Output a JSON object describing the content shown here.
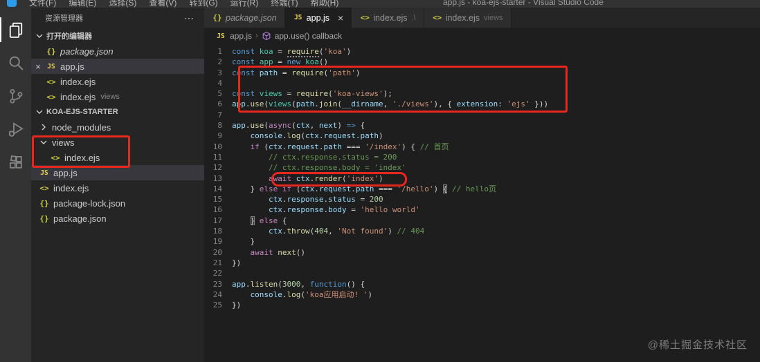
{
  "palette": {
    "annotation_red": "#e8261d",
    "activity_bar_bg": "#333333",
    "sidebar_bg": "#252526",
    "editor_bg": "#1e1e1e",
    "tab_active_bg": "#1e1e1e",
    "tab_inactive_bg": "#2d2d2d",
    "selection_row_bg": "#37373d",
    "keyword_blue": "#569cd6",
    "keyword_purple": "#c586c0",
    "class_teal": "#4ec9b0",
    "variable_blue": "#9cdcfe",
    "function_yellow": "#dcdcaa",
    "string_orange": "#ce9178",
    "number_green": "#b5cea8",
    "comment_green": "#6a9955"
  },
  "window": {
    "title": "app.js - koa-ejs-starter - Visual Studio Code",
    "menu_items": [
      "文件(F)",
      "编辑(E)",
      "选择(S)",
      "查看(V)",
      "转到(G)",
      "运行(R)",
      "终端(T)",
      "帮助(H)"
    ]
  },
  "activity_bar": [
    {
      "name": "explorer",
      "active": true
    },
    {
      "name": "search",
      "active": false
    },
    {
      "name": "source-control",
      "active": false
    },
    {
      "name": "run-debug",
      "active": false
    },
    {
      "name": "extensions",
      "active": false
    }
  ],
  "sidebar": {
    "title": "资源管理器",
    "actions_label": "⋯",
    "open_editors_label": "打开的编辑器",
    "open_editors": [
      {
        "label": "package.json",
        "icon": "json",
        "italic": true,
        "active": false,
        "close": ""
      },
      {
        "label": "app.js",
        "icon": "js",
        "italic": false,
        "active": true,
        "close": "×"
      },
      {
        "label": "index.ejs",
        "icon": "ejs",
        "italic": false,
        "active": false,
        "close": ""
      },
      {
        "label": "index.ejs",
        "icon": "ejs",
        "suffix": "views",
        "italic": false,
        "active": false,
        "close": ""
      }
    ],
    "project_label": "KOA-EJS-STARTER",
    "tree": [
      {
        "label": "node_modules",
        "kind": "folder",
        "state": "collapsed",
        "indent": 0,
        "selected": false
      },
      {
        "label": "views",
        "kind": "folder",
        "state": "expanded",
        "indent": 0,
        "selected": false
      },
      {
        "label": "index.ejs",
        "kind": "file",
        "icon": "ejs",
        "indent": 1,
        "selected": false
      },
      {
        "label": "app.js",
        "kind": "file",
        "icon": "js",
        "indent": 0,
        "selected": true
      },
      {
        "label": "index.ejs",
        "kind": "file",
        "icon": "ejs",
        "indent": 0,
        "selected": false
      },
      {
        "label": "package-lock.json",
        "kind": "file",
        "icon": "json",
        "indent": 0,
        "selected": false
      },
      {
        "label": "package.json",
        "kind": "file",
        "icon": "json",
        "indent": 0,
        "selected": false
      }
    ]
  },
  "file_icons": {
    "json": "{}",
    "js": "JS",
    "ejs": "<>"
  },
  "tabs": [
    {
      "label": "package.json",
      "icon": "json",
      "italic": true,
      "active": false,
      "suffix": "",
      "close": ""
    },
    {
      "label": "app.js",
      "icon": "js",
      "italic": false,
      "active": true,
      "suffix": "",
      "close": "×"
    },
    {
      "label": "index.ejs",
      "icon": "ejs",
      "italic": false,
      "active": false,
      "suffix": ".\\",
      "close": ""
    },
    {
      "label": "index.ejs",
      "icon": "ejs",
      "italic": false,
      "active": false,
      "suffix": "views",
      "close": ""
    }
  ],
  "breadcrumb": {
    "file": "app.js",
    "separator": "›",
    "symbol": "app.use() callback"
  },
  "editor": {
    "lines": [
      {
        "n": "1",
        "tokens": [
          {
            "c": "kw",
            "t": "const "
          },
          {
            "c": "cls",
            "t": "koa"
          },
          {
            "c": "pun",
            "t": " = "
          },
          {
            "c": "fn",
            "t": "require",
            "u": 1
          },
          {
            "c": "pun",
            "t": "("
          },
          {
            "c": "str",
            "t": "'koa'"
          },
          {
            "c": "pun",
            "t": ")"
          }
        ]
      },
      {
        "n": "2",
        "tokens": [
          {
            "c": "kw",
            "t": "const "
          },
          {
            "c": "cls",
            "t": "app"
          },
          {
            "c": "pun",
            "t": " = "
          },
          {
            "c": "kw",
            "t": "new"
          },
          {
            "c": "pun",
            "t": " "
          },
          {
            "c": "cls",
            "t": "koa"
          },
          {
            "c": "pun",
            "t": "()"
          }
        ]
      },
      {
        "n": "3",
        "tokens": [
          {
            "c": "kw",
            "t": "const "
          },
          {
            "c": "var",
            "t": "path"
          },
          {
            "c": "pun",
            "t": " = "
          },
          {
            "c": "fn",
            "t": "require"
          },
          {
            "c": "pun",
            "t": "("
          },
          {
            "c": "str",
            "t": "'path'"
          },
          {
            "c": "pun",
            "t": ")"
          }
        ]
      },
      {
        "n": "4",
        "tokens": []
      },
      {
        "n": "5",
        "tokens": [
          {
            "c": "kw",
            "t": "const "
          },
          {
            "c": "cls",
            "t": "views"
          },
          {
            "c": "pun",
            "t": " = "
          },
          {
            "c": "fn",
            "t": "require"
          },
          {
            "c": "pun",
            "t": "("
          },
          {
            "c": "str",
            "t": "'koa-views'"
          },
          {
            "c": "pun",
            "t": ");"
          }
        ]
      },
      {
        "n": "6",
        "tokens": [
          {
            "c": "var",
            "t": "app"
          },
          {
            "c": "pun",
            "t": "."
          },
          {
            "c": "fn",
            "t": "use"
          },
          {
            "c": "pun",
            "t": "("
          },
          {
            "c": "cls",
            "t": "views"
          },
          {
            "c": "pun",
            "t": "("
          },
          {
            "c": "var",
            "t": "path"
          },
          {
            "c": "pun",
            "t": "."
          },
          {
            "c": "fn",
            "t": "join"
          },
          {
            "c": "pun",
            "t": "("
          },
          {
            "c": "var",
            "t": "__dirname"
          },
          {
            "c": "pun",
            "t": ", "
          },
          {
            "c": "str",
            "t": "'./views'"
          },
          {
            "c": "pun",
            "t": "), { "
          },
          {
            "c": "var",
            "t": "extension"
          },
          {
            "c": "pun",
            "t": ": "
          },
          {
            "c": "str",
            "t": "'ejs'"
          },
          {
            "c": "pun",
            "t": " }))"
          }
        ]
      },
      {
        "n": "7",
        "tokens": []
      },
      {
        "n": "8",
        "tokens": [
          {
            "c": "var",
            "t": "app"
          },
          {
            "c": "pun",
            "t": "."
          },
          {
            "c": "fn",
            "t": "use"
          },
          {
            "c": "pun",
            "t": "("
          },
          {
            "c": "ctrl",
            "t": "async"
          },
          {
            "c": "pun",
            "t": "("
          },
          {
            "c": "var",
            "t": "ctx"
          },
          {
            "c": "pun",
            "t": ", "
          },
          {
            "c": "var",
            "t": "next"
          },
          {
            "c": "pun",
            "t": ") "
          },
          {
            "c": "kw",
            "t": "=>"
          },
          {
            "c": "pun",
            "t": " {"
          }
        ]
      },
      {
        "n": "9",
        "tokens": [
          {
            "c": "pun",
            "t": "    "
          },
          {
            "c": "var",
            "t": "console"
          },
          {
            "c": "pun",
            "t": "."
          },
          {
            "c": "fn",
            "t": "log"
          },
          {
            "c": "pun",
            "t": "("
          },
          {
            "c": "var",
            "t": "ctx"
          },
          {
            "c": "pun",
            "t": "."
          },
          {
            "c": "var",
            "t": "request"
          },
          {
            "c": "pun",
            "t": "."
          },
          {
            "c": "var",
            "t": "path"
          },
          {
            "c": "pun",
            "t": ")"
          }
        ]
      },
      {
        "n": "10",
        "tokens": [
          {
            "c": "pun",
            "t": "    "
          },
          {
            "c": "ctrl",
            "t": "if"
          },
          {
            "c": "pun",
            "t": " ("
          },
          {
            "c": "var",
            "t": "ctx"
          },
          {
            "c": "pun",
            "t": "."
          },
          {
            "c": "var",
            "t": "request"
          },
          {
            "c": "pun",
            "t": "."
          },
          {
            "c": "var",
            "t": "path"
          },
          {
            "c": "pun",
            "t": " === "
          },
          {
            "c": "str",
            "t": "'/index'"
          },
          {
            "c": "pun",
            "t": ") { "
          },
          {
            "c": "com",
            "t": "// 首页"
          }
        ]
      },
      {
        "n": "11",
        "tokens": [
          {
            "c": "pun",
            "t": "        "
          },
          {
            "c": "com",
            "t": "// ctx.response.status = 200"
          }
        ]
      },
      {
        "n": "12",
        "tokens": [
          {
            "c": "pun",
            "t": "        "
          },
          {
            "c": "com",
            "t": "// ctx.response.body = 'index'"
          }
        ]
      },
      {
        "n": "13",
        "tokens": [
          {
            "c": "pun",
            "t": "        "
          },
          {
            "c": "ctrl",
            "t": "await"
          },
          {
            "c": "pun",
            "t": " "
          },
          {
            "c": "var",
            "t": "ctx"
          },
          {
            "c": "pun",
            "t": "."
          },
          {
            "c": "fn",
            "t": "render"
          },
          {
            "c": "pun",
            "t": "("
          },
          {
            "c": "str",
            "t": "'index'"
          },
          {
            "c": "pun",
            "t": ")"
          }
        ]
      },
      {
        "n": "14",
        "tokens": [
          {
            "c": "pun",
            "t": "    } "
          },
          {
            "c": "ctrl",
            "t": "else"
          },
          {
            "c": "pun",
            "t": " "
          },
          {
            "c": "ctrl",
            "t": "if"
          },
          {
            "c": "pun",
            "t": " ("
          },
          {
            "c": "var",
            "t": "ctx"
          },
          {
            "c": "pun",
            "t": "."
          },
          {
            "c": "var",
            "t": "request"
          },
          {
            "c": "pun",
            "t": "."
          },
          {
            "c": "var",
            "t": "path"
          },
          {
            "c": "pun",
            "t": " === "
          },
          {
            "c": "str",
            "t": "'/hello'"
          },
          {
            "c": "pun",
            "t": ") "
          },
          {
            "c": "pun",
            "t": "{",
            "b": 1
          },
          {
            "c": "pun",
            "t": " "
          },
          {
            "c": "com",
            "t": "// hello页"
          }
        ]
      },
      {
        "n": "15",
        "tokens": [
          {
            "c": "pun",
            "t": "        "
          },
          {
            "c": "var",
            "t": "ctx"
          },
          {
            "c": "pun",
            "t": "."
          },
          {
            "c": "var",
            "t": "response"
          },
          {
            "c": "pun",
            "t": "."
          },
          {
            "c": "var",
            "t": "status"
          },
          {
            "c": "pun",
            "t": " = "
          },
          {
            "c": "num",
            "t": "200"
          }
        ]
      },
      {
        "n": "16",
        "tokens": [
          {
            "c": "pun",
            "t": "        "
          },
          {
            "c": "var",
            "t": "ctx"
          },
          {
            "c": "pun",
            "t": "."
          },
          {
            "c": "var",
            "t": "response"
          },
          {
            "c": "pun",
            "t": "."
          },
          {
            "c": "var",
            "t": "body"
          },
          {
            "c": "pun",
            "t": " = "
          },
          {
            "c": "str",
            "t": "'hello world'"
          }
        ]
      },
      {
        "n": "17",
        "tokens": [
          {
            "c": "pun",
            "t": "    "
          },
          {
            "c": "pun",
            "t": "}",
            "b": 1
          },
          {
            "c": "pun",
            "t": " "
          },
          {
            "c": "ctrl",
            "t": "else"
          },
          {
            "c": "pun",
            "t": " {"
          }
        ]
      },
      {
        "n": "18",
        "tokens": [
          {
            "c": "pun",
            "t": "        "
          },
          {
            "c": "var",
            "t": "ctx"
          },
          {
            "c": "pun",
            "t": "."
          },
          {
            "c": "fn",
            "t": "throw"
          },
          {
            "c": "pun",
            "t": "("
          },
          {
            "c": "num",
            "t": "404"
          },
          {
            "c": "pun",
            "t": ", "
          },
          {
            "c": "str",
            "t": "'Not found'"
          },
          {
            "c": "pun",
            "t": ") "
          },
          {
            "c": "com",
            "t": "// 404"
          }
        ]
      },
      {
        "n": "19",
        "tokens": [
          {
            "c": "pun",
            "t": "    }"
          }
        ]
      },
      {
        "n": "20",
        "tokens": [
          {
            "c": "pun",
            "t": "    "
          },
          {
            "c": "ctrl",
            "t": "await"
          },
          {
            "c": "pun",
            "t": " "
          },
          {
            "c": "fn",
            "t": "next"
          },
          {
            "c": "pun",
            "t": "()"
          }
        ]
      },
      {
        "n": "21",
        "tokens": [
          {
            "c": "pun",
            "t": "})"
          }
        ]
      },
      {
        "n": "22",
        "tokens": []
      },
      {
        "n": "23",
        "tokens": [
          {
            "c": "var",
            "t": "app"
          },
          {
            "c": "pun",
            "t": "."
          },
          {
            "c": "fn",
            "t": "listen"
          },
          {
            "c": "pun",
            "t": "("
          },
          {
            "c": "num",
            "t": "3000"
          },
          {
            "c": "pun",
            "t": ", "
          },
          {
            "c": "kw",
            "t": "function"
          },
          {
            "c": "pun",
            "t": "() {"
          }
        ]
      },
      {
        "n": "24",
        "tokens": [
          {
            "c": "pun",
            "t": "    "
          },
          {
            "c": "var",
            "t": "console"
          },
          {
            "c": "pun",
            "t": "."
          },
          {
            "c": "fn",
            "t": "log"
          },
          {
            "c": "pun",
            "t": "("
          },
          {
            "c": "str",
            "t": "'koa应用启动! '"
          },
          {
            "c": "pun",
            "t": ")"
          }
        ]
      },
      {
        "n": "25",
        "tokens": [
          {
            "c": "pun",
            "t": "})"
          }
        ]
      }
    ]
  },
  "watermark": "@稀土掘金技术社区"
}
